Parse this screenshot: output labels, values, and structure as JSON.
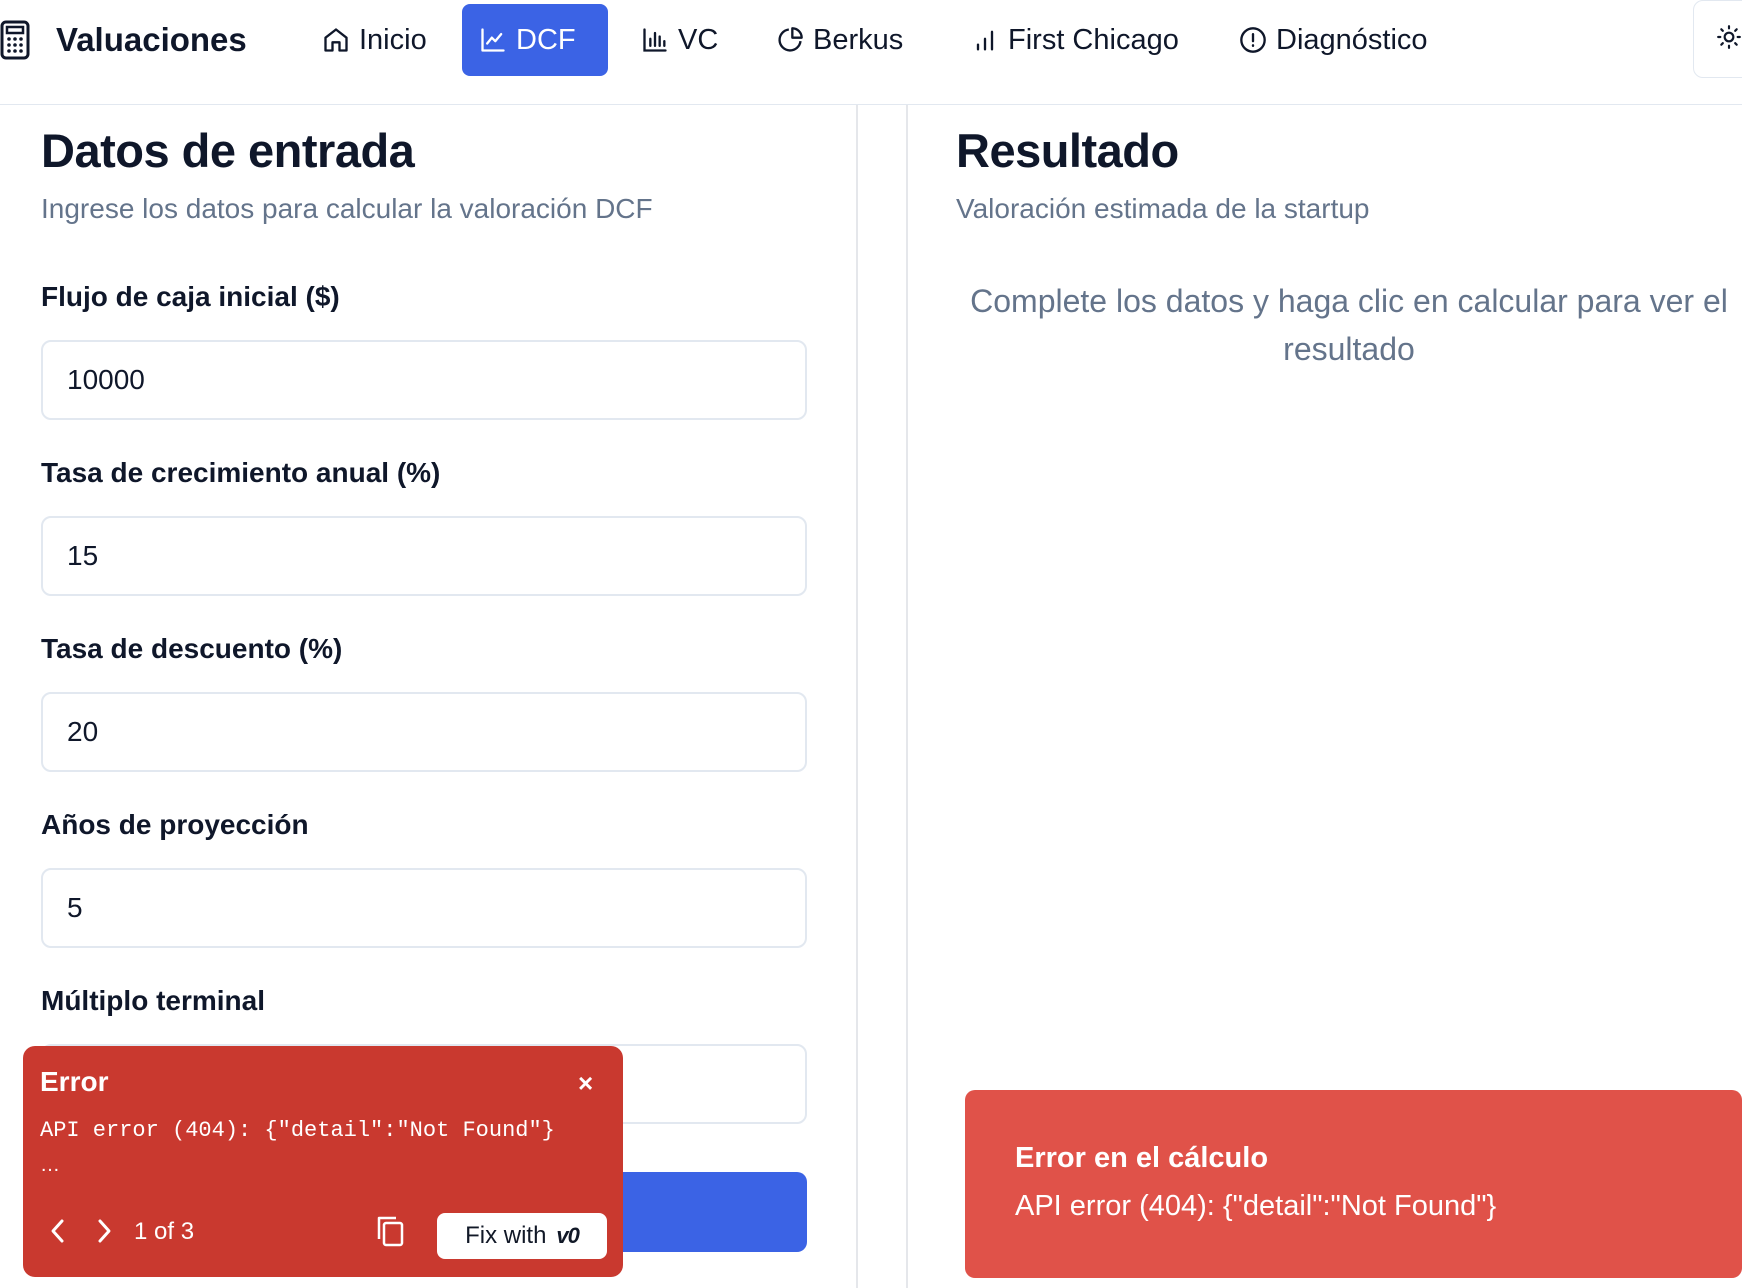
{
  "app": {
    "title": "Valuaciones"
  },
  "nav": {
    "items": [
      {
        "label": "Inicio",
        "icon": "home-icon"
      },
      {
        "label": "DCF",
        "icon": "line-chart-icon",
        "active": true
      },
      {
        "label": "VC",
        "icon": "bar-chart-icon"
      },
      {
        "label": "Berkus",
        "icon": "pie-chart-icon"
      },
      {
        "label": "First Chicago",
        "icon": "signal-bars-icon"
      },
      {
        "label": "Diagnóstico",
        "icon": "alert-circle-icon"
      }
    ],
    "theme_toggle_icon": "sun-icon"
  },
  "form": {
    "title": "Datos de entrada",
    "description": "Ingrese los datos para calcular la valoración DCF",
    "fields": [
      {
        "label": "Flujo de caja inicial ($)",
        "value": "10000"
      },
      {
        "label": "Tasa de crecimiento anual (%)",
        "value": "15"
      },
      {
        "label": "Tasa de descuento (%)",
        "value": "20"
      },
      {
        "label": "Años de proyección",
        "value": "5"
      },
      {
        "label": "Múltiplo terminal",
        "value": ""
      }
    ]
  },
  "result": {
    "title": "Resultado",
    "description": "Valoración estimada de la startup",
    "empty_message": "Complete los datos y haga clic en calcular para ver el resultado"
  },
  "error_overlay": {
    "title": "Error",
    "close": "×",
    "message": "API error (404): {\"detail\":\"Not Found\"}",
    "ellipsis": "…",
    "counter": "1 of 3",
    "fix_label": "Fix with",
    "fix_logo": "v0"
  },
  "toast": {
    "title": "Error en el cálculo",
    "message": "API error (404): {\"detail\":\"Not Found\"}"
  },
  "colors": {
    "accent": "#3b63e5",
    "overlay_red": "#c9392f",
    "toast_red": "#e05249",
    "muted_text": "#64748b"
  }
}
